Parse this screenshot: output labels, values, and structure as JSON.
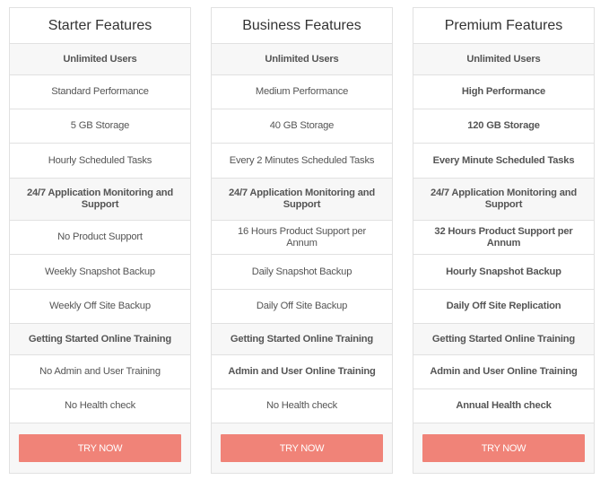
{
  "colors": {
    "button_bg": "#f08378",
    "button_text": "#ffffff",
    "shaded_row": "#f7f7f7",
    "border": "#e1e1e1"
  },
  "plans": [
    {
      "title": "Starter Features",
      "features": [
        {
          "label": "Unlimited Users",
          "bold": true
        },
        {
          "label": "Standard Performance",
          "bold": false
        },
        {
          "label": "5 GB Storage",
          "bold": false
        },
        {
          "label": "Hourly Scheduled Tasks",
          "bold": false
        },
        {
          "label": "24/7 Application Monitoring and Support",
          "bold": true
        },
        {
          "label": "No Product Support",
          "bold": false
        },
        {
          "label": "Weekly Snapshot Backup",
          "bold": false
        },
        {
          "label": "Weekly Off Site Backup",
          "bold": false
        },
        {
          "label": "Getting Started Online Training",
          "bold": true
        },
        {
          "label": "No Admin and User Training",
          "bold": false
        },
        {
          "label": "No Health check",
          "bold": false
        }
      ],
      "button_label": "TRY NOW"
    },
    {
      "title": "Business Features",
      "features": [
        {
          "label": "Unlimited Users",
          "bold": true
        },
        {
          "label": "Medium Performance",
          "bold": false
        },
        {
          "label": "40 GB Storage",
          "bold": false
        },
        {
          "label": "Every 2 Minutes Scheduled Tasks",
          "bold": false
        },
        {
          "label": "24/7 Application Monitoring and Support",
          "bold": true
        },
        {
          "label": "16 Hours Product Support per Annum",
          "bold": false
        },
        {
          "label": "Daily Snapshot Backup",
          "bold": false
        },
        {
          "label": "Daily Off Site Backup",
          "bold": false
        },
        {
          "label": "Getting Started Online Training",
          "bold": true
        },
        {
          "label": "Admin and User Online Training",
          "bold": true
        },
        {
          "label": "No Health check",
          "bold": false
        }
      ],
      "button_label": "TRY NOW"
    },
    {
      "title": "Premium Features",
      "features": [
        {
          "label": "Unlimited Users",
          "bold": true
        },
        {
          "label": "High Performance",
          "bold": true
        },
        {
          "label": "120 GB Storage",
          "bold": true
        },
        {
          "label": "Every Minute Scheduled Tasks",
          "bold": true
        },
        {
          "label": "24/7 Application Monitoring and Support",
          "bold": true
        },
        {
          "label": "32 Hours Product Support per Annum",
          "bold": true
        },
        {
          "label": "Hourly Snapshot Backup",
          "bold": true
        },
        {
          "label": "Daily Off Site Replication",
          "bold": true
        },
        {
          "label": "Getting Started Online Training",
          "bold": true
        },
        {
          "label": "Admin and User Online Training",
          "bold": true
        },
        {
          "label": "Annual Health check",
          "bold": true
        }
      ],
      "button_label": "TRY NOW"
    }
  ]
}
